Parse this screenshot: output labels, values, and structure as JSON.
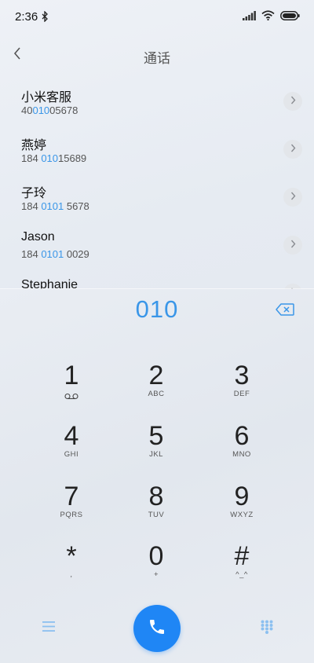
{
  "status": {
    "time": "2:36"
  },
  "header": {
    "title": "通话"
  },
  "results": [
    {
      "name": "小米客服",
      "number_parts": [
        "40",
        "010",
        "05678"
      ]
    },
    {
      "name": "燕婷",
      "number_parts": [
        "184 ",
        "010",
        "15689"
      ]
    },
    {
      "name": "子玲",
      "number_parts": [
        "184 ",
        "0101",
        " 5678"
      ]
    },
    {
      "name": "Jason",
      "number_parts": [
        "184 ",
        "0101",
        " 0029"
      ]
    },
    {
      "name": "Stephanie",
      "number_parts": [
        "",
        "",
        ""
      ]
    }
  ],
  "dialer": {
    "dialed": "010"
  },
  "keypad": [
    {
      "digit": "1",
      "letters": "",
      "sub": "voicemail-icon"
    },
    {
      "digit": "2",
      "letters": "ABC"
    },
    {
      "digit": "3",
      "letters": "DEF"
    },
    {
      "digit": "4",
      "letters": "GHI"
    },
    {
      "digit": "5",
      "letters": "JKL"
    },
    {
      "digit": "6",
      "letters": "MNO"
    },
    {
      "digit": "7",
      "letters": "PQRS"
    },
    {
      "digit": "8",
      "letters": "TUV"
    },
    {
      "digit": "9",
      "letters": "WXYZ"
    },
    {
      "digit": "*",
      "letters": ","
    },
    {
      "digit": "0",
      "letters": "+"
    },
    {
      "digit": "#",
      "letters": "^_^"
    }
  ],
  "colors": {
    "accent": "#3a96e8",
    "call": "#1f86f5"
  }
}
